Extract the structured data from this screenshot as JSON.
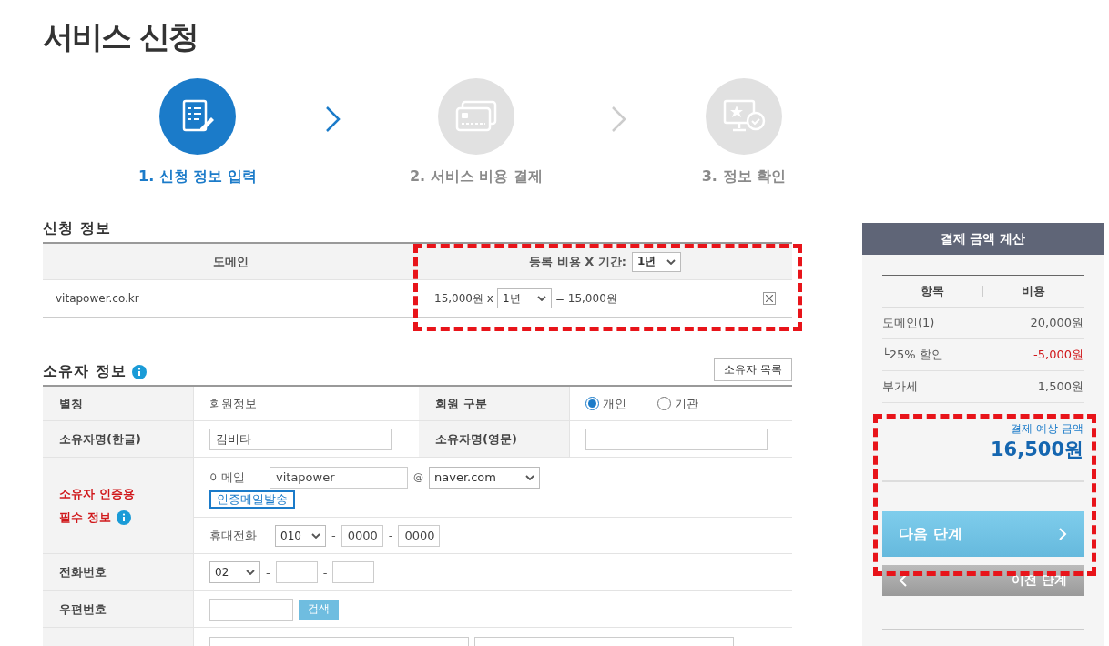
{
  "title": "서비스 신청",
  "steps": [
    {
      "label": "1. 신청 정보 입력",
      "kind": "form",
      "selected": true
    },
    {
      "label": "2. 서비스 비용 결제",
      "kind": "card",
      "selected": false
    },
    {
      "label": "3. 정보 확인",
      "kind": "monitor",
      "selected": false
    }
  ],
  "application": {
    "title": "신청 정보",
    "columns": [
      "도메인",
      "등록 비용 X 기간:"
    ],
    "period_select": "1년",
    "rows": [
      {
        "domain": "vitapower.co.kr",
        "price": "15,000원 x",
        "period": "1년",
        "total": "= 15,000원"
      }
    ]
  },
  "owner": {
    "title": "소유자 정보",
    "list_button": "소유자 목록",
    "alias": {
      "label": "별칭",
      "value": "회원정보"
    },
    "member_type": {
      "label": "회원 구분",
      "options": [
        {
          "label": "개인",
          "selected": true
        },
        {
          "label": "기관",
          "selected": false
        }
      ]
    },
    "name_ko": {
      "label": "소유자명(한글)",
      "value": "김비타"
    },
    "name_en": {
      "label": "소유자명(영문)"
    },
    "verification": {
      "label_lines": [
        "소유자 인증용",
        "필수 정보"
      ],
      "email": {
        "label": "이메일",
        "user": "vitapower",
        "at": "@",
        "domain": "naver.com",
        "send_button": "인증메일발송"
      },
      "mobile": {
        "label": "휴대전화",
        "prefix": "010",
        "separator": "-",
        "part2": "0000",
        "part3": "0000"
      }
    },
    "phone": {
      "label": "전화번호",
      "prefix": "02",
      "separator": "-"
    },
    "zip": {
      "label": "우편번호",
      "search_button": "검색"
    }
  },
  "summary": {
    "title": "결제 금액 계산",
    "columns": [
      "항목",
      "비용"
    ],
    "items": [
      {
        "name": "도메인(1)",
        "amount": "20,000원",
        "kind": "normal"
      },
      {
        "name": "└25% 할인",
        "amount": "-5,000원",
        "kind": "discount"
      },
      {
        "name": "부가세",
        "amount": "1,500원",
        "kind": "normal"
      }
    ],
    "total_label": "결제 예상 금액",
    "total": "16,500원",
    "next_button": "다음 단계",
    "prev_button": "이전 단계"
  }
}
